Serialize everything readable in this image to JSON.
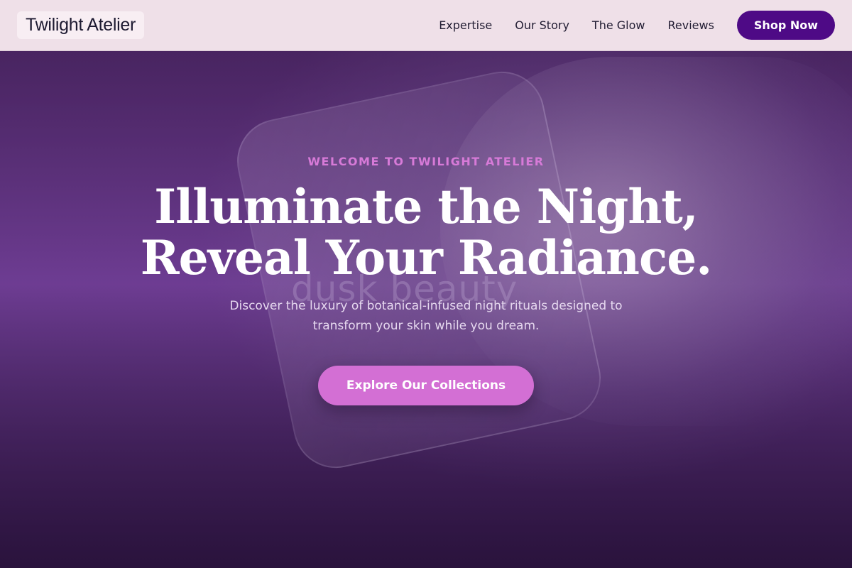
{
  "header": {
    "brand": "Twilight Atelier",
    "nav": [
      {
        "label": "Expertise"
      },
      {
        "label": "Our Story"
      },
      {
        "label": "The Glow"
      },
      {
        "label": "Reviews"
      }
    ],
    "cta_label": "Shop Now"
  },
  "hero": {
    "eyebrow": "WELCOME TO TWILIGHT ATELIER",
    "headline_line1": "Illuminate the Night,",
    "headline_line2": "Reveal Your Radiance.",
    "subtext": "Discover the luxury of botanical-infused night rituals designed to transform your skin while you dream.",
    "cta_label": "Explore Our Collections",
    "jar_watermark": "dusk beauty"
  },
  "colors": {
    "brand_purple": "#4e0a86",
    "accent_pink": "#d36fd4",
    "eyebrow_pink": "#d77ad8",
    "nav_bg": "#efe0e8"
  }
}
